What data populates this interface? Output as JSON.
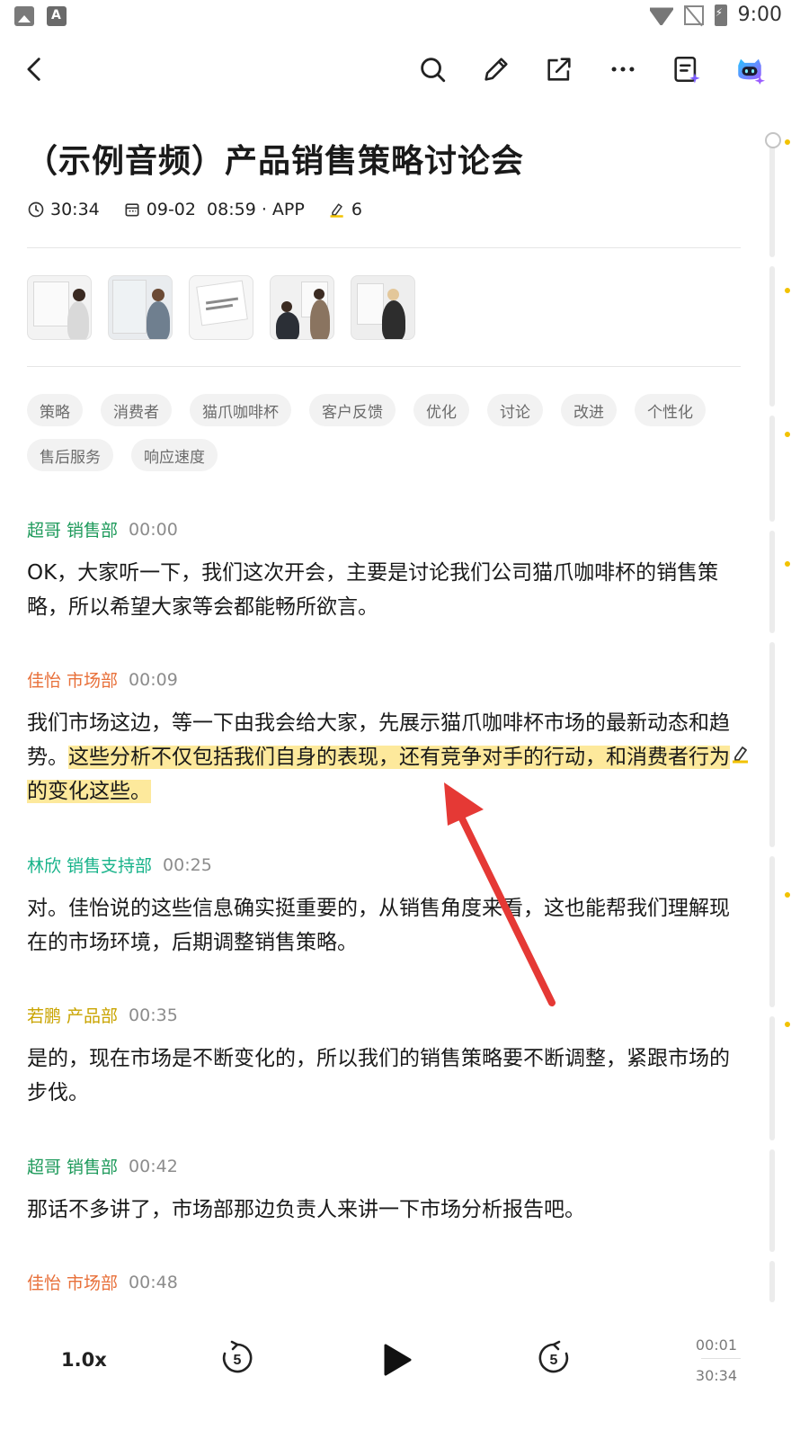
{
  "status_bar": {
    "time": "9:00"
  },
  "toolbar": {
    "icons": [
      "back-icon",
      "search-icon",
      "edit-icon",
      "share-icon",
      "more-icon",
      "summary-icon",
      "ai-assistant-icon"
    ]
  },
  "recording": {
    "title": "（示例音频）产品销售策略讨论会",
    "duration": "30:34",
    "date_source": "09-02  08:59 · APP",
    "highlight_count": "6"
  },
  "thumbnails": [
    "image-1",
    "image-2",
    "image-3",
    "image-4",
    "image-5"
  ],
  "tags": [
    "策略",
    "消费者",
    "猫爪咖啡杯",
    "客户反馈",
    "优化",
    "讨论",
    "改进",
    "个性化",
    "售后服务",
    "响应速度"
  ],
  "transcript": [
    {
      "speaker": "超哥 销售部",
      "time": "00:00",
      "color": "#1e9a5b",
      "text": "OK，大家听一下，我们这次开会，主要是讨论我们公司猫爪咖啡杯的销售策略，所以希望大家等会都能畅所欲言。"
    },
    {
      "speaker": "佳怡 市场部",
      "time": "00:09",
      "color": "#e8703a",
      "text_plain": "我们市场这边，等一下由我会给大家，先展示猫爪咖啡杯市场的最新动态和趋势。",
      "text_highlight": "这些分析不仅包括我们自身的表现，还有竞争对手的行动，和消费者行为的变化这些。"
    },
    {
      "speaker": "林欣 销售支持部",
      "time": "00:25",
      "color": "#18b38a",
      "text": "对。佳怡说的这些信息确实挺重要的，从销售角度来看，这也能帮我们理解现在的市场环境，后期调整销售策略。"
    },
    {
      "speaker": "若鹏 产品部",
      "time": "00:35",
      "color": "#c9a400",
      "text": "是的，现在市场是不断变化的，所以我们的销售策略要不断调整，紧跟市场的步伐。"
    },
    {
      "speaker": "超哥 销售部",
      "time": "00:42",
      "color": "#1e9a5b",
      "text": "那话不多讲了，市场部那边负责人来讲一下市场分析报告吧。"
    },
    {
      "speaker": "佳怡 市场部",
      "time": "00:48",
      "color": "#e8703a"
    }
  ],
  "player": {
    "speed": "1.0x",
    "rewind_seconds": "5",
    "forward_seconds": "5",
    "current_time": "00:01",
    "total_time": "30:34",
    "progress_fraction": 0.0005
  },
  "colors": {
    "highlight": "#fde99c",
    "accent_yellow": "#f2c200",
    "annotation_red": "#e53935"
  }
}
